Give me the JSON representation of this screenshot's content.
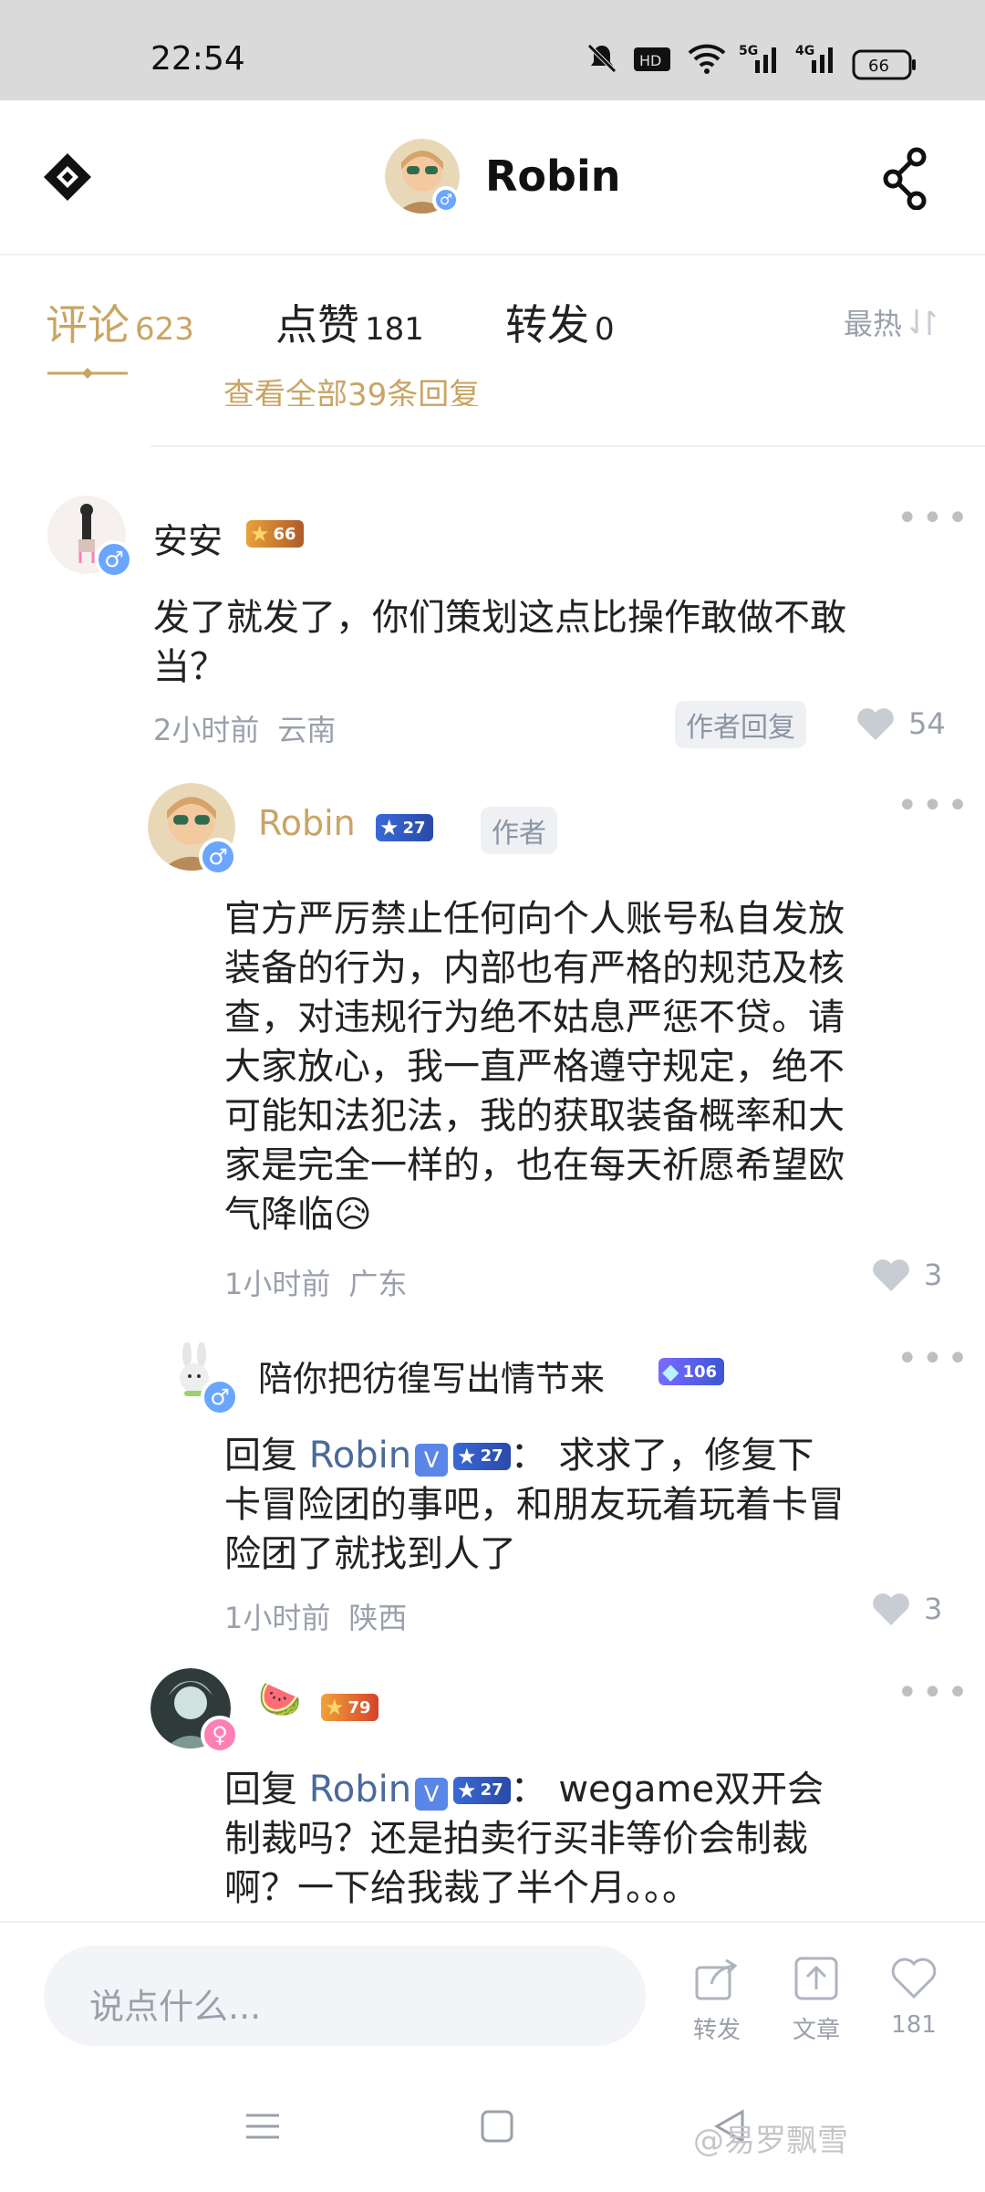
{
  "status_bar": {
    "time": "22:54",
    "battery": "66",
    "network": [
      "5G",
      "4G"
    ]
  },
  "header": {
    "title": "Robin"
  },
  "tabs": [
    {
      "label": "评论",
      "count": "623",
      "active": true
    },
    {
      "label": "点赞",
      "count": "181"
    },
    {
      "label": "转发",
      "count": "0"
    }
  ],
  "sort": {
    "label": "最热"
  },
  "partial_reply": "查看全部39条回复",
  "comments": [
    {
      "user": "安安",
      "level": "66",
      "text": "发了就发了，你们策划这点比操作敢做不敢当？",
      "time": "2小时前",
      "location": "云南",
      "author_reply_tag": "作者回复",
      "likes": "54"
    },
    {
      "user": "Robin",
      "level": "27",
      "tag": "作者",
      "text": "官方严厉禁止任何向个人账号私自发放装备的行为，内部也有严格的规范及核查，对违规行为绝不姑息严惩不贷。请大家放心，我一直严格遵守规定，绝不可能知法犯法，我的获取装备概率和大家是完全一样的，也在每天祈愿希望欧气降临😥",
      "time": "1小时前",
      "location": "广东",
      "likes": "3"
    },
    {
      "user": "陪你把彷徨写出情节来",
      "level": "106",
      "reply_prefix": "回复",
      "reply_to": "Robin",
      "reply_to_level": "27",
      "text": "：  求求了，修复下卡冒险团的事吧，和朋友玩着玩着卡冒险团了就找到人了",
      "time": "1小时前",
      "location": "陕西",
      "likes": "3"
    },
    {
      "user": "🍉",
      "level": "79",
      "reply_prefix": "回复",
      "reply_to": "Robin",
      "reply_to_level": "27",
      "text": "：  wegame双开会制裁吗？还是拍卖行买非等价会制裁啊？一下给我裁了半个月。。。"
    }
  ],
  "bottom_bar": {
    "input_placeholder": "说点什么...",
    "actions": [
      {
        "label": "转发",
        "icon": "share-out-icon"
      },
      {
        "label": "文章",
        "icon": "upload-icon"
      },
      {
        "label": "181",
        "icon": "heart-icon"
      }
    ]
  },
  "watermark": "@易罗飘雪",
  "colors": {
    "accent": "#c9a463",
    "muted": "#9aa0ab",
    "link": "#4a6a9a"
  }
}
